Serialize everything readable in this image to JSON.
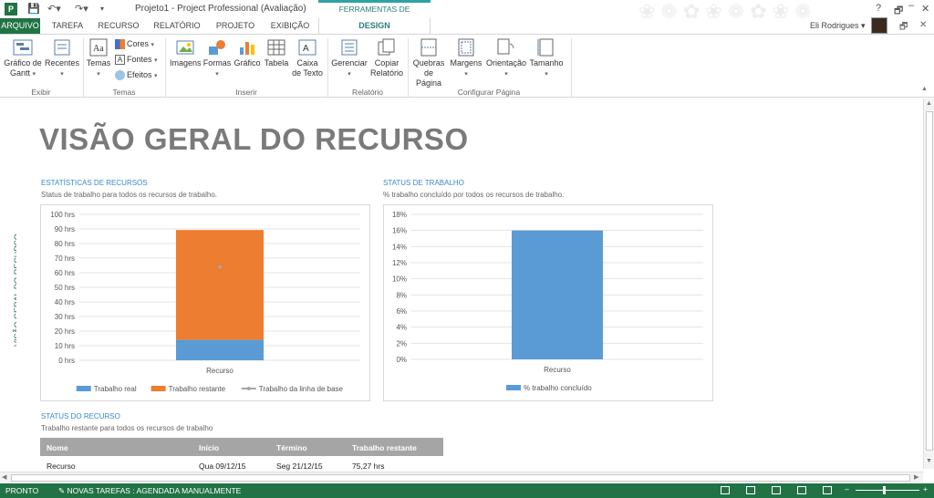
{
  "window": {
    "title": "Projeto1 - Project Professional (Avaliação)",
    "context_tab_group": "FERRAMENTAS DE RELATÓRIO",
    "user": "Eli Rodrigues",
    "controls": [
      "?",
      "🗗",
      "–",
      "🗖",
      "✕"
    ]
  },
  "tabs": [
    "ARQUIVO",
    "TAREFA",
    "RECURSO",
    "RELATÓRIO",
    "PROJETO",
    "EXIBIÇÃO",
    "DESIGN"
  ],
  "ribbon": {
    "groups": [
      {
        "label": "Exibir"
      },
      {
        "label": "Temas"
      },
      {
        "label": "Inserir"
      },
      {
        "label": "Relatório"
      },
      {
        "label": "Configurar Página"
      }
    ],
    "buttons": {
      "gantt": "Gráfico de Gantt",
      "recentes": "Recentes",
      "temas": "Temas",
      "cores": "Cores",
      "fontes": "Fontes",
      "efeitos": "Efeitos",
      "imagens": "Imagens",
      "formas": "Formas",
      "grafico": "Gráfico",
      "tabela": "Tabela",
      "caixa_texto": "Caixa de Texto",
      "gerenciar": "Gerenciar",
      "copiar": "Copiar Relatório",
      "quebras": "Quebras de Página",
      "margens": "Margens",
      "orientacao": "Orientação",
      "tamanho": "Tamanho"
    }
  },
  "side_label": "VISÃO GERAL DO RECURSO",
  "report": {
    "title": "VISÃO GERAL DO RECURSO",
    "stats_section": {
      "title": "ESTATÍSTICAS DE RECURSOS",
      "subtitle": "Status de trabalho para todos os recursos de trabalho."
    },
    "work_section": {
      "title": "STATUS DE TRABALHO",
      "subtitle": "% trabalho concluído por todos os recursos de trabalho."
    },
    "resource_section": {
      "title": "STATUS DO RECURSO",
      "subtitle": "Trabalho restante para todos os recursos de trabalho"
    },
    "table": {
      "headers": [
        "Nome",
        "Início",
        "Término",
        "Trabalho restante"
      ],
      "rows": [
        [
          "Recurso",
          "Qua 09/12/15",
          "Seg 21/12/15",
          "75,27 hrs"
        ]
      ]
    }
  },
  "chart_data": [
    {
      "type": "bar",
      "stacked": true,
      "categories": [
        "Recurso"
      ],
      "series": [
        {
          "name": "Trabalho real",
          "values": [
            14
          ],
          "color": "#5b9bd5"
        },
        {
          "name": "Trabalho restante",
          "values": [
            75.27
          ],
          "color": "#ed7d31"
        },
        {
          "name": "Trabalho da linha de base",
          "values": [
            64
          ],
          "color": "#a5a5a5",
          "style": "line-marker"
        }
      ],
      "ylim": [
        0,
        100
      ],
      "yticks": [
        "0 hrs",
        "10 hrs",
        "20 hrs",
        "30 hrs",
        "40 hrs",
        "50 hrs",
        "60 hrs",
        "70 hrs",
        "80 hrs",
        "90 hrs",
        "100 hrs"
      ],
      "grid": true,
      "legend": "bottom"
    },
    {
      "type": "bar",
      "categories": [
        "Recurso"
      ],
      "series": [
        {
          "name": "% trabalho concluído",
          "values": [
            16
          ],
          "color": "#5b9bd5"
        }
      ],
      "ylim": [
        0,
        18
      ],
      "yticks": [
        "0%",
        "2%",
        "4%",
        "6%",
        "8%",
        "10%",
        "12%",
        "14%",
        "16%",
        "18%"
      ],
      "grid": true,
      "legend": "bottom"
    }
  ],
  "status_bar": {
    "ready": "PRONTO",
    "new_tasks": "NOVAS TAREFAS : AGENDADA MANUALMENTE"
  }
}
